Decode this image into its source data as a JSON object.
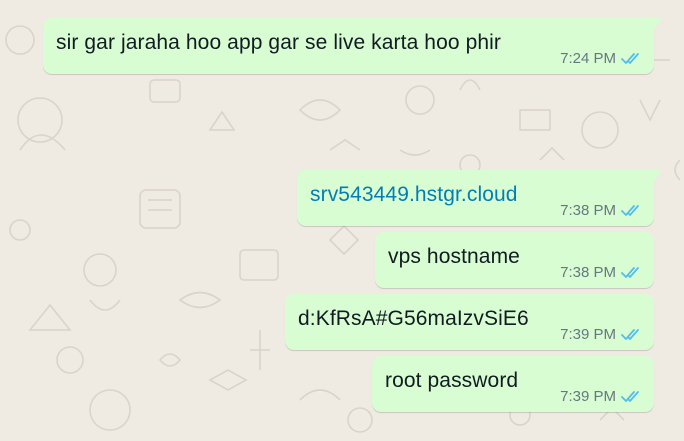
{
  "chat": {
    "messages": [
      {
        "text": "sir gar jaraha hoo app gar se live karta hoo phir",
        "time": "7:24 PM",
        "status": "read",
        "is_link": false
      },
      {
        "text": "srv543449.hstgr.cloud",
        "time": "7:38 PM",
        "status": "read",
        "is_link": true
      },
      {
        "text": "vps hostname",
        "time": "7:38 PM",
        "status": "read",
        "is_link": false
      },
      {
        "text": "d:KfRsA#G56maIzvSiE6",
        "time": "7:39 PM",
        "status": "read",
        "is_link": false
      },
      {
        "text": "root password",
        "time": "7:39 PM",
        "status": "read",
        "is_link": false
      }
    ]
  },
  "colors": {
    "background": "#efeae2",
    "bubble_outgoing": "#d9fdd3",
    "text": "#111b21",
    "link": "#027eb5",
    "meta": "#667781",
    "read_ticks": "#53bdeb"
  },
  "icons": {
    "read_receipt": "double-check-icon"
  }
}
